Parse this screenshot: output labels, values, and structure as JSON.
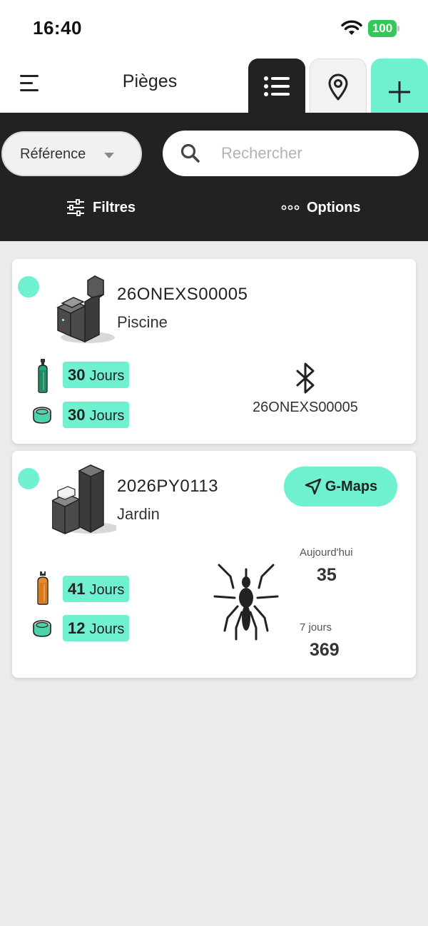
{
  "status_bar": {
    "time": "16:40",
    "battery": "100"
  },
  "header": {
    "title": "Pièges",
    "tabs": [
      {
        "icon": "list-icon",
        "active": true
      },
      {
        "icon": "map-pin-icon",
        "active": false
      },
      {
        "icon": "plus-icon",
        "active": false
      }
    ]
  },
  "toolbar": {
    "sort_select": "Référence",
    "search_placeholder": "Rechercher",
    "filters_label": "Filtres",
    "options_label": "Options"
  },
  "colors": {
    "accent": "#6ff0cf",
    "dark": "#222222",
    "battery": "#34c759"
  },
  "traps": [
    {
      "reference": "26ONEXS00005",
      "location": "Piscine",
      "status_color": "#6ff0cf",
      "gas_days": "30",
      "lure_days": "30",
      "days_unit": "Jours",
      "connection_icon": "bluetooth-icon",
      "connection_id": "26ONEXS00005"
    },
    {
      "reference": "2026PY0113",
      "location": "Jardin",
      "status_color": "#6ff0cf",
      "gas_days": "41",
      "lure_days": "12",
      "days_unit": "Jours",
      "maps_button": "G-Maps",
      "today_label": "Aujourd'hui",
      "today_count": "35",
      "week_label": "7 jours",
      "week_count": "369"
    }
  ]
}
